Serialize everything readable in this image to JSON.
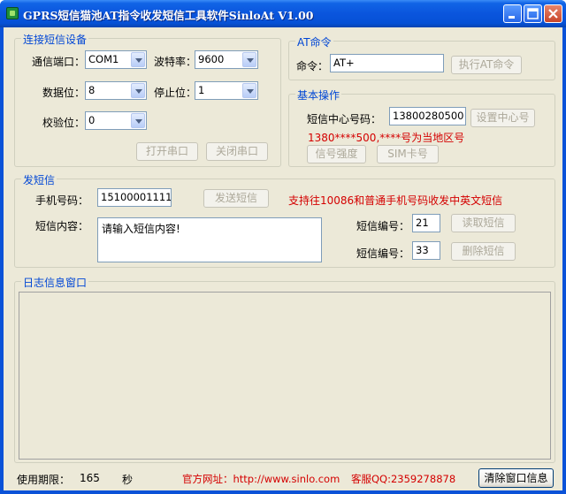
{
  "window": {
    "title": "GPRS短信猫池AT指令收发短信工具软件SinloAt V1.00"
  },
  "serial": {
    "group_label": "连接短信设备",
    "port_label": "通信端口：",
    "port_value": "COM1",
    "baud_label": "波特率：",
    "baud_value": "9600",
    "databits_label": "数据位：",
    "databits_value": "8",
    "stopbits_label": "停止位：",
    "stopbits_value": "1",
    "parity_label": "校验位：",
    "parity_value": "0",
    "open_label": "打开串口",
    "close_label": "关闭串口"
  },
  "at": {
    "group_label": "AT命令",
    "cmd_label": "命令：",
    "cmd_value": "AT+",
    "exec_label": "执行AT命令"
  },
  "basic": {
    "group_label": "基本操作",
    "center_label": "短信中心号码：",
    "center_value": "13800280500",
    "set_center_label": "设置中心号",
    "hint": "1380****500,****号为当地区号",
    "signal_label": "信号强度",
    "sim_label": "SIM卡号"
  },
  "sms": {
    "group_label": "发短信",
    "phone_label": "手机号码：",
    "phone_value": "15100001111",
    "send_label": "发送短信",
    "support_text": "支持往10086和普通手机号码收发中英文短信",
    "content_label": "短信内容：",
    "content_value": "请输入短信内容!",
    "read_index_label": "短信编号：",
    "read_index_value": "21",
    "read_label": "读取短信",
    "del_index_label": "短信编号：",
    "del_index_value": "33",
    "del_label": "删除短信"
  },
  "log": {
    "group_label": "日志信息窗口"
  },
  "status": {
    "period_label": "使用期限：",
    "period_value": "165",
    "period_unit": "秒",
    "site_text": "官方网址：http://www.sinlo.com",
    "qq_text": "客服QQ:2359278878",
    "clear_label": "清除窗口信息"
  },
  "colors": {
    "title_bar": "#0a55dd",
    "group_label": "#0046d5",
    "accent_red": "#d40000",
    "face": "#ece9d8"
  }
}
